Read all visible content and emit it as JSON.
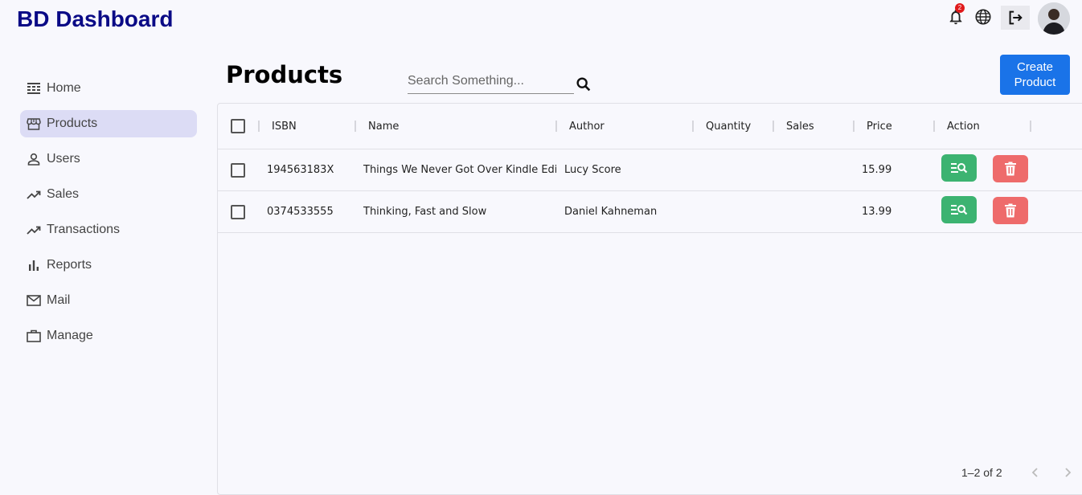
{
  "app": {
    "title": "BD Dashboard"
  },
  "header": {
    "notification_count": "2"
  },
  "sidebar": {
    "items": [
      {
        "label": "Home",
        "icon": "home-icon"
      },
      {
        "label": "Products",
        "icon": "store-icon",
        "active": true
      },
      {
        "label": "Users",
        "icon": "person-icon"
      },
      {
        "label": "Sales",
        "icon": "trending-up-icon"
      },
      {
        "label": "Transactions",
        "icon": "trending-up-icon"
      },
      {
        "label": "Reports",
        "icon": "bar-chart-icon"
      },
      {
        "label": "Mail",
        "icon": "mail-icon"
      },
      {
        "label": "Manage",
        "icon": "briefcase-icon"
      }
    ]
  },
  "main": {
    "title": "Products",
    "search": {
      "placeholder": "Search Something...",
      "value": ""
    },
    "create_button": "Create Product"
  },
  "table": {
    "columns": [
      "ISBN",
      "Name",
      "Author",
      "Quantity",
      "Sales",
      "Price",
      "Action"
    ],
    "rows": [
      {
        "isbn": "194563183X",
        "name": "Things We Never Got Over Kindle Edition",
        "author": "Lucy Score",
        "quantity": "",
        "sales": "",
        "price": "15.99"
      },
      {
        "isbn": "0374533555",
        "name": "Thinking, Fast and Slow",
        "author": "Daniel Kahneman",
        "quantity": "",
        "sales": "",
        "price": "13.99"
      }
    ],
    "pagination": "1–2 of 2"
  },
  "colors": {
    "brand": "#0a0a86",
    "primary": "#1a73e8",
    "view": "#3cb371",
    "delete": "#ee6b6b",
    "active_nav": "#dcdcf5"
  }
}
